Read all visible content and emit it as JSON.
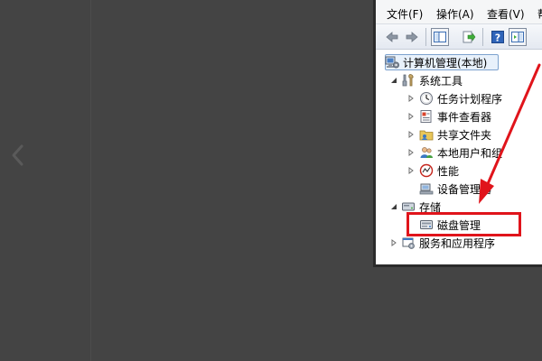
{
  "menubar": {
    "file": "文件(F)",
    "action": "操作(A)",
    "view": "查看(V)",
    "help": "帮"
  },
  "toolbar": {
    "icons": [
      "back-arrow-icon",
      "forward-arrow-icon",
      "show-hide-console-tree-icon",
      "export-list-icon",
      "help-icon",
      "show-hide-action-pane-icon"
    ]
  },
  "tree": {
    "root": "计算机管理(本地)",
    "system_tools": "系统工具",
    "task_scheduler": "任务计划程序",
    "event_viewer": "事件查看器",
    "shared_folders": "共享文件夹",
    "local_users": "本地用户和组",
    "performance": "性能",
    "device_manager": "设备管理器",
    "storage": "存储",
    "disk_management": "磁盘管理",
    "services_apps": "服务和应用程序"
  },
  "colors": {
    "annotation": "#e0141b",
    "background": "#444444"
  }
}
